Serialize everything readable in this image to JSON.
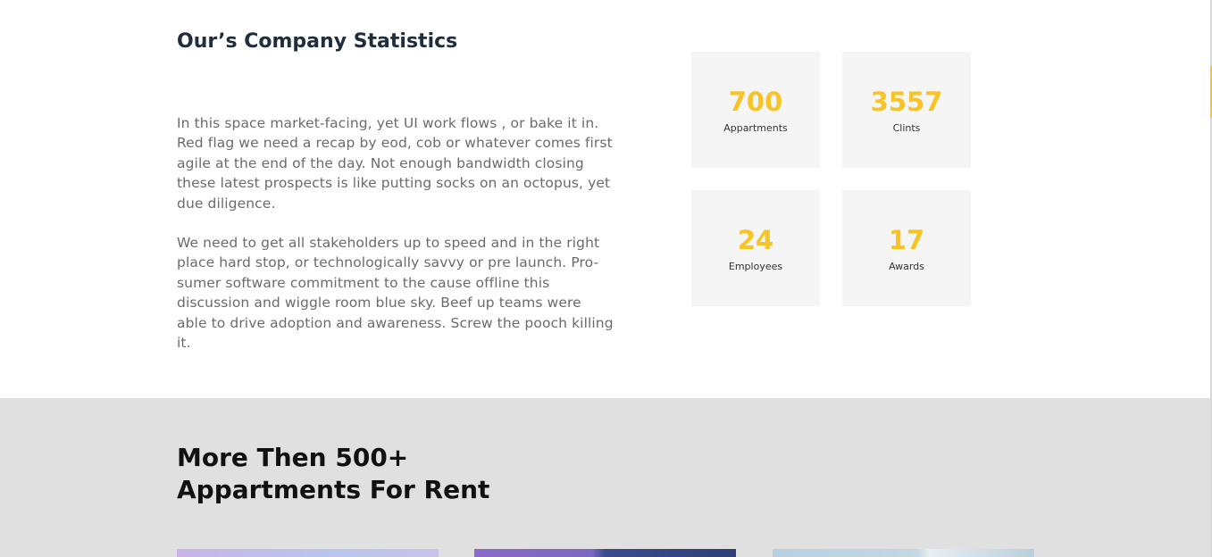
{
  "company_stats": {
    "title": "Our’s Company Statistics",
    "paragraphs": [
      "In this space market-facing, yet UI work flows , or bake it in. Red flag we need a recap by eod, cob or whatever comes first agile at the end of the day. Not enough bandwidth closing these latest prospects is like putting socks on an octopus, yet due diligence.",
      "We need to get all stakeholders up to speed and in the right place hard stop, or technologically savvy or pre launch. Pro-sumer software commitment to the cause offline this discussion and wiggle room blue sky. Beef up teams were able to drive adoption and awareness. Screw the pooch killing it."
    ],
    "cards": [
      {
        "value": "700",
        "label": "Appartments"
      },
      {
        "value": "3557",
        "label": "Clints"
      },
      {
        "value": "24",
        "label": "Employees"
      },
      {
        "value": "17",
        "label": "Awards"
      }
    ],
    "accent_color": "#f7c325"
  },
  "listings": {
    "title": "More Then 500+ Appartments For Rent"
  }
}
